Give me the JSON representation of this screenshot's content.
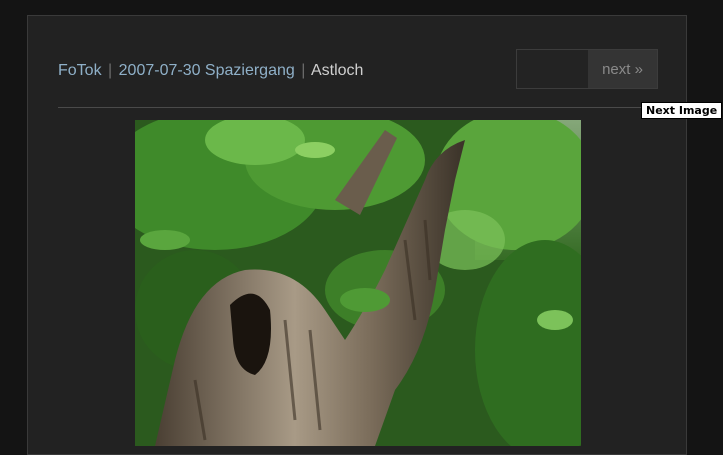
{
  "breadcrumb": {
    "home": "FoTok",
    "separator": "|",
    "album": "2007-07-30 Spaziergang",
    "current": "Astloch"
  },
  "nav": {
    "next_label": "next »"
  },
  "tooltip": {
    "text": "Next Image"
  },
  "photo": {
    "subject": "tree-trunk-with-knothole"
  },
  "colors": {
    "background": "#141414",
    "panel": "#222222",
    "link": "#8fb0c8",
    "text": "#cfcfcf"
  }
}
